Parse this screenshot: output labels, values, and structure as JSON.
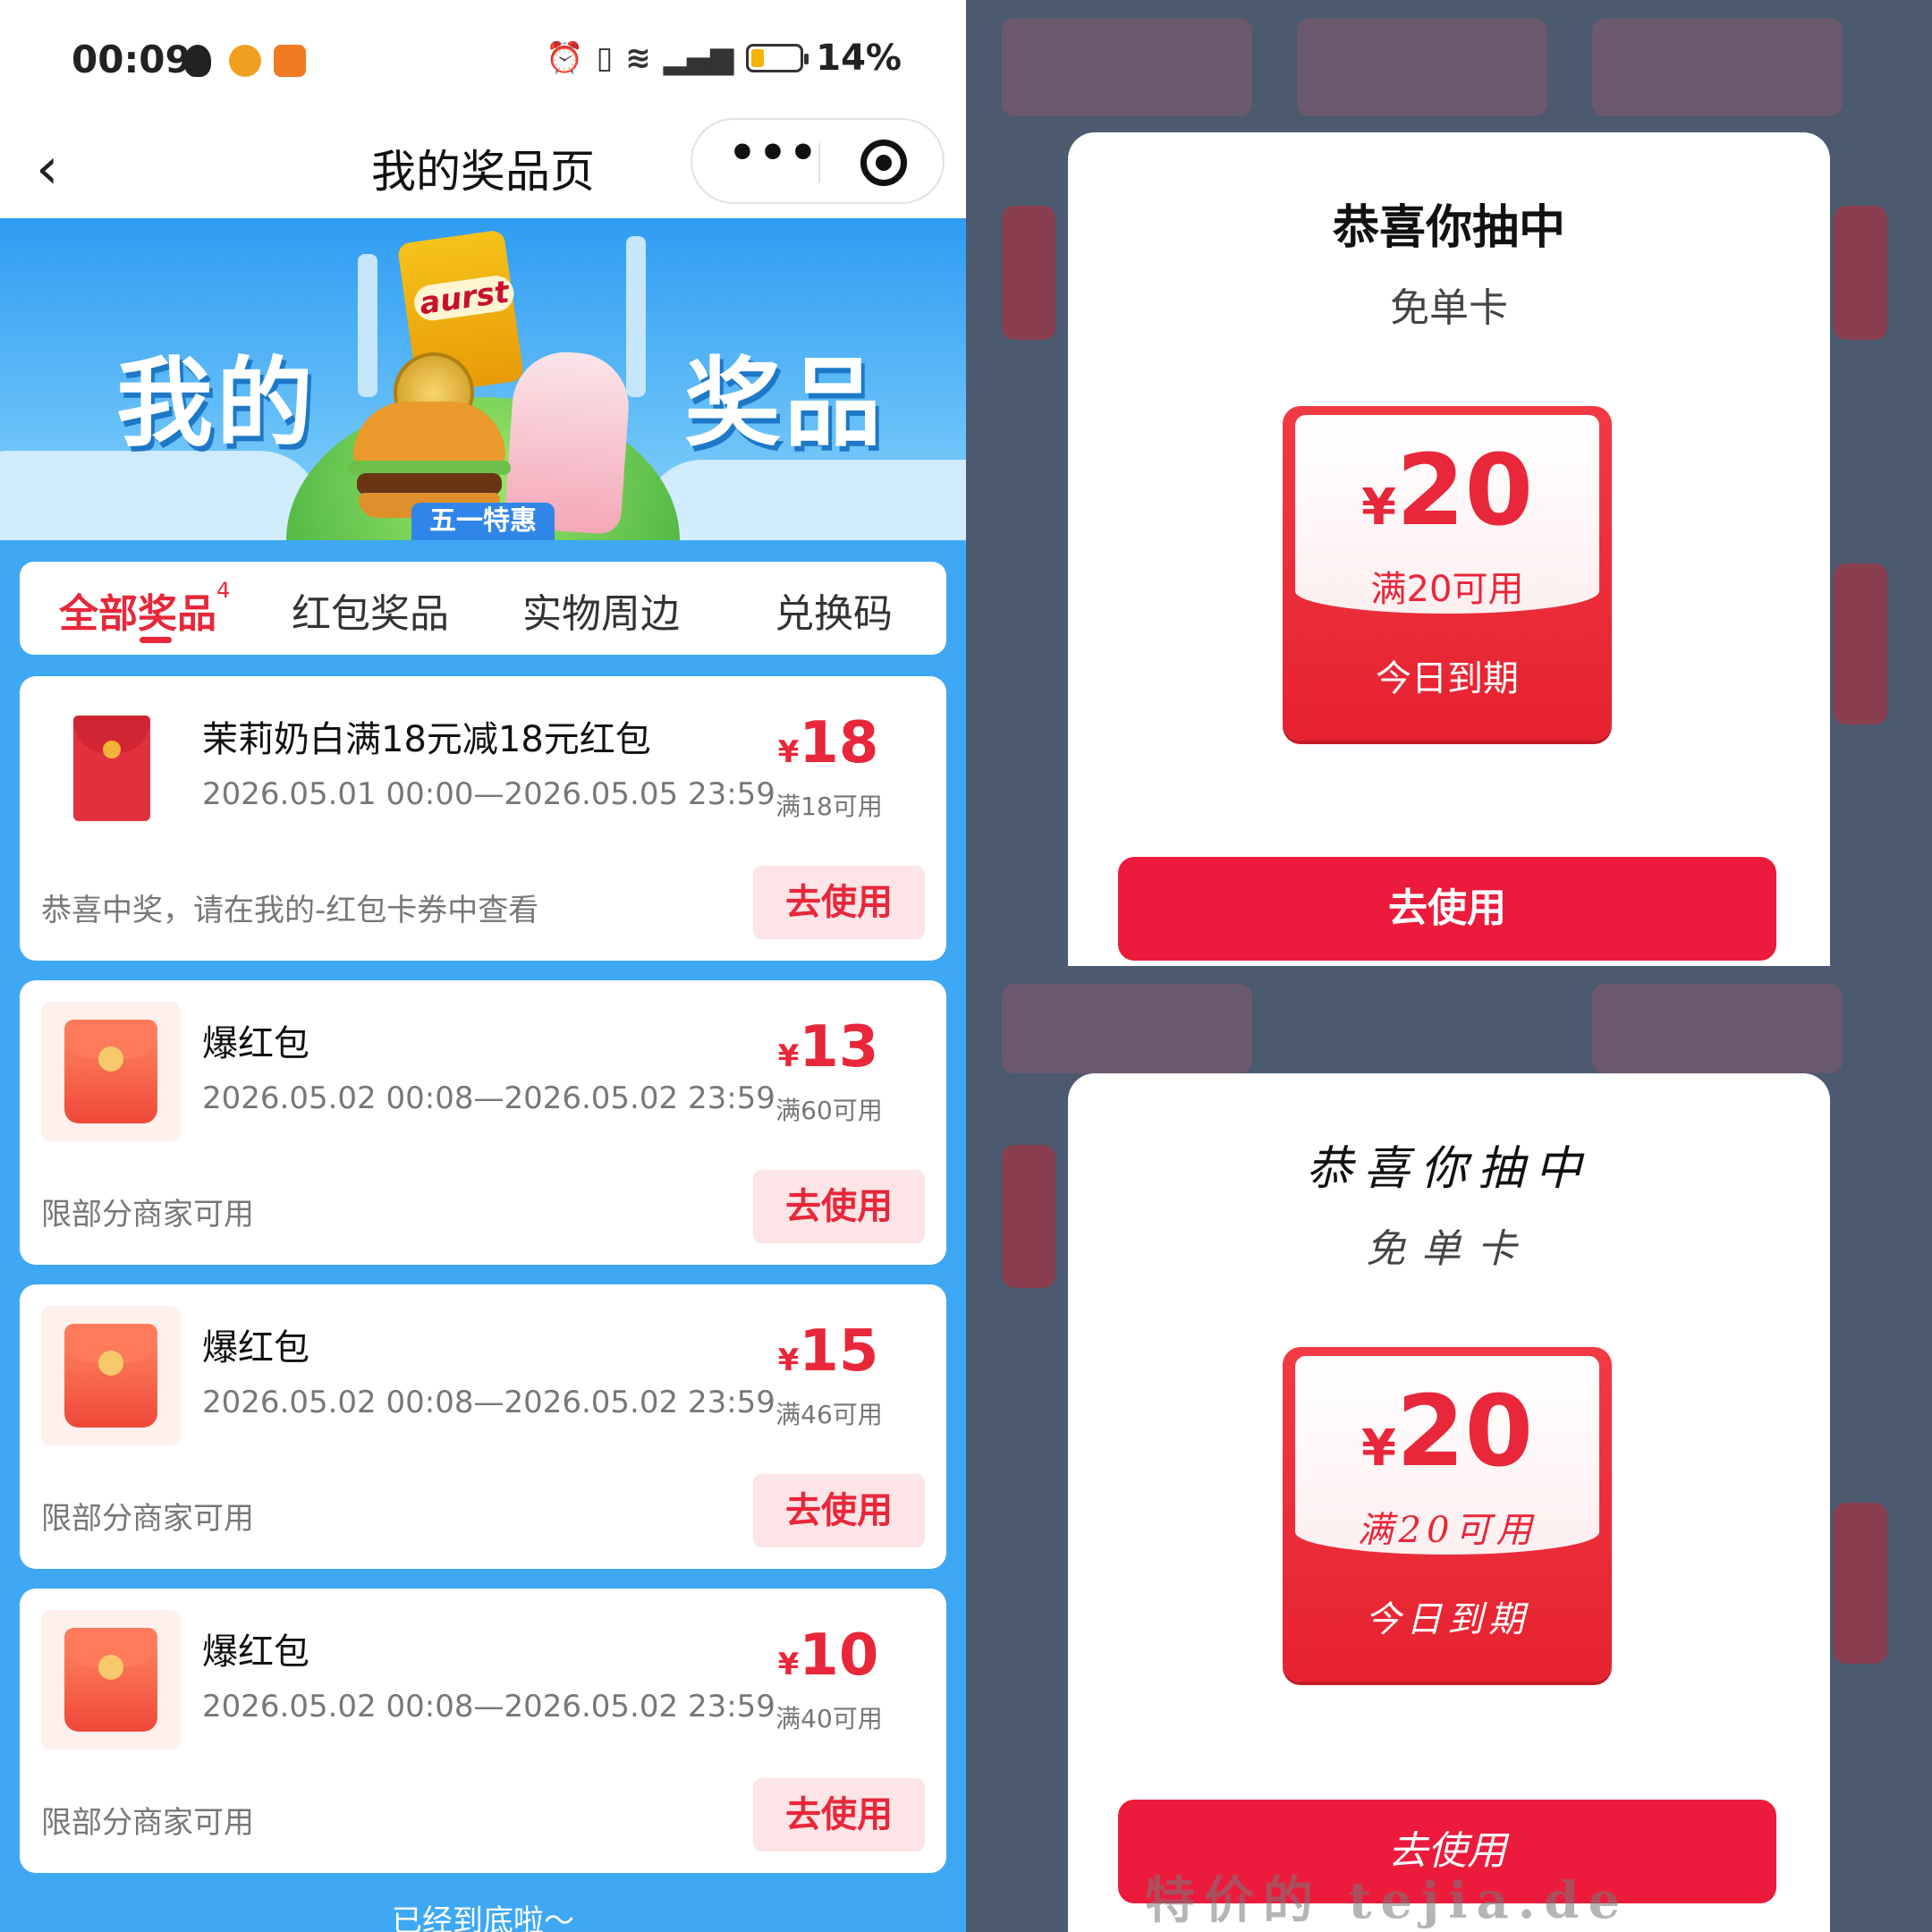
{
  "status_bar": {
    "time": "00:09",
    "battery": "14%",
    "icons": [
      "qq-icon",
      "weibo-icon",
      "app-icon",
      "alarm-icon",
      "vibrate-icon",
      "wifi-icon",
      "signal-5g-icon",
      "battery-icon"
    ]
  },
  "navbar": {
    "back_icon": "chevron-left-icon",
    "title": "我的奖品页",
    "more_label": "•••",
    "target_icon": "target-icon"
  },
  "banner": {
    "word_left": "我的",
    "word_right": "奖品",
    "chips_label": "aurst",
    "ribbon": "五一特惠"
  },
  "tabs": [
    {
      "label": "全部奖品",
      "badge": "4",
      "active": true
    },
    {
      "label": "红包奖品",
      "active": false
    },
    {
      "label": "实物周边",
      "active": false
    },
    {
      "label": "兑换码",
      "active": false
    }
  ],
  "prizes": [
    {
      "name": "茉莉奶白满18元减18元红包",
      "date": "2026.05.01 00:00—2026.05.05 23:59",
      "yen": "¥",
      "amount": "18",
      "condition": "满18可用",
      "note": "恭喜中奖，请在我的-红包卡券中查看",
      "button": "去使用"
    },
    {
      "name": "爆红包",
      "date": "2026.05.02 00:08—2026.05.02 23:59",
      "yen": "¥",
      "amount": "13",
      "condition": "满60可用",
      "note": "限部分商家可用",
      "button": "去使用"
    },
    {
      "name": "爆红包",
      "date": "2026.05.02 00:08—2026.05.02 23:59",
      "yen": "¥",
      "amount": "15",
      "condition": "满46可用",
      "note": "限部分商家可用",
      "button": "去使用"
    },
    {
      "name": "爆红包",
      "date": "2026.05.02 00:08—2026.05.02 23:59",
      "yen": "¥",
      "amount": "10",
      "condition": "满40可用",
      "note": "限部分商家可用",
      "button": "去使用"
    }
  ],
  "bottom_text": "已经到底啦～",
  "popup_top": {
    "title": "恭喜你抽中",
    "subtitle": "免单卡",
    "yen": "¥",
    "amount": "20",
    "condition": "满20可用",
    "expire": "今日到期",
    "button": "去使用"
  },
  "popup_bottom": {
    "title": "恭喜你抽中",
    "subtitle": "免单卡",
    "yen": "¥",
    "amount": "20",
    "condition": "满20可用",
    "expire": "今日到期",
    "button": "去使用"
  },
  "watermark": "特价的 tejia.de",
  "colors": {
    "accent_red": "#e8273a",
    "button_red": "#ec1b3c",
    "page_blue": "#3ea8f4"
  }
}
